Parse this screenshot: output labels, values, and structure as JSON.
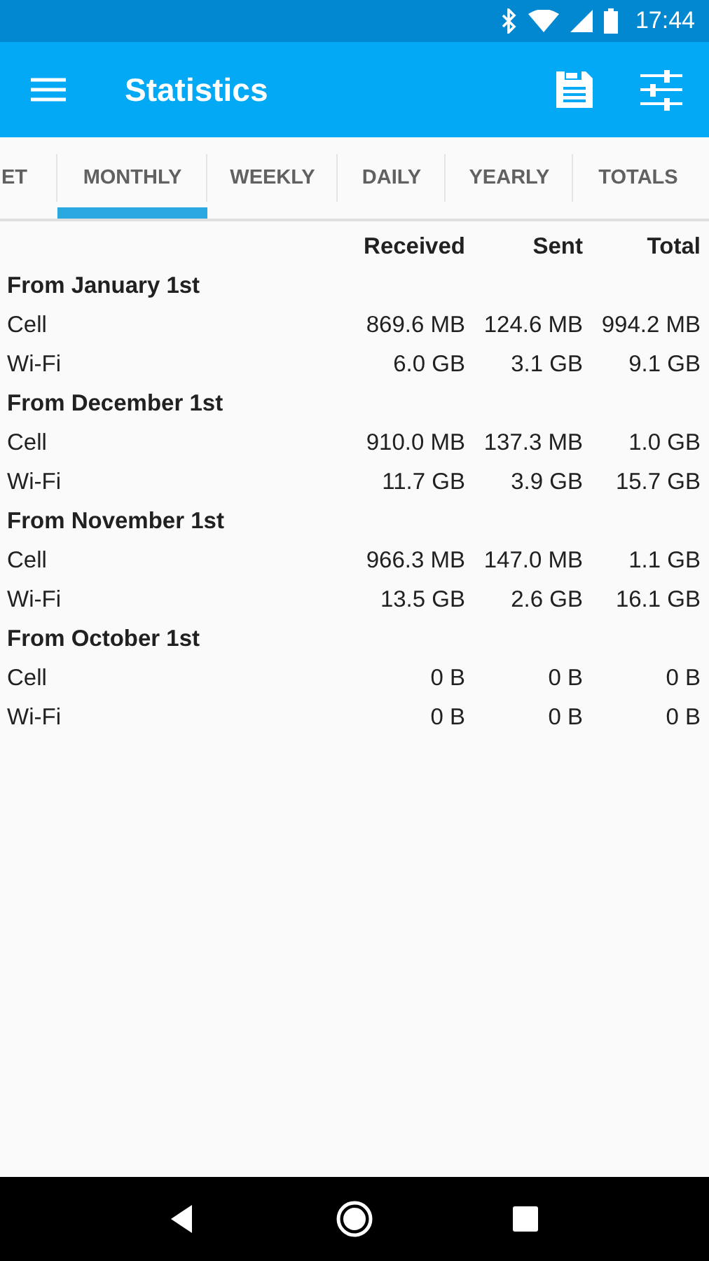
{
  "status_bar": {
    "time": "17:44"
  },
  "app_bar": {
    "title": "Statistics"
  },
  "tabs": [
    {
      "label": "ET",
      "selected": false
    },
    {
      "label": "MONTHLY",
      "selected": true
    },
    {
      "label": "WEEKLY",
      "selected": false
    },
    {
      "label": "DAILY",
      "selected": false
    },
    {
      "label": "YEARLY",
      "selected": false
    },
    {
      "label": "TOTALS",
      "selected": false
    }
  ],
  "table": {
    "columns": [
      "Received",
      "Sent",
      "Total"
    ],
    "groups": [
      {
        "title": "From January 1st",
        "rows": [
          {
            "label": "Cell",
            "values": [
              "869.6 MB",
              "124.6 MB",
              "994.2 MB"
            ]
          },
          {
            "label": "Wi-Fi",
            "values": [
              "6.0 GB",
              "3.1 GB",
              "9.1 GB"
            ]
          }
        ]
      },
      {
        "title": "From December 1st",
        "rows": [
          {
            "label": "Cell",
            "values": [
              "910.0 MB",
              "137.3 MB",
              "1.0 GB"
            ]
          },
          {
            "label": "Wi-Fi",
            "values": [
              "11.7 GB",
              "3.9 GB",
              "15.7 GB"
            ]
          }
        ]
      },
      {
        "title": "From November 1st",
        "rows": [
          {
            "label": "Cell",
            "values": [
              "966.3 MB",
              "147.0 MB",
              "1.1 GB"
            ]
          },
          {
            "label": "Wi-Fi",
            "values": [
              "13.5 GB",
              "2.6 GB",
              "16.1 GB"
            ]
          }
        ]
      },
      {
        "title": "From October 1st",
        "rows": [
          {
            "label": "Cell",
            "values": [
              "0 B",
              "0 B",
              "0 B"
            ]
          },
          {
            "label": "Wi-Fi",
            "values": [
              "0 B",
              "0 B",
              "0 B"
            ]
          }
        ]
      }
    ]
  }
}
